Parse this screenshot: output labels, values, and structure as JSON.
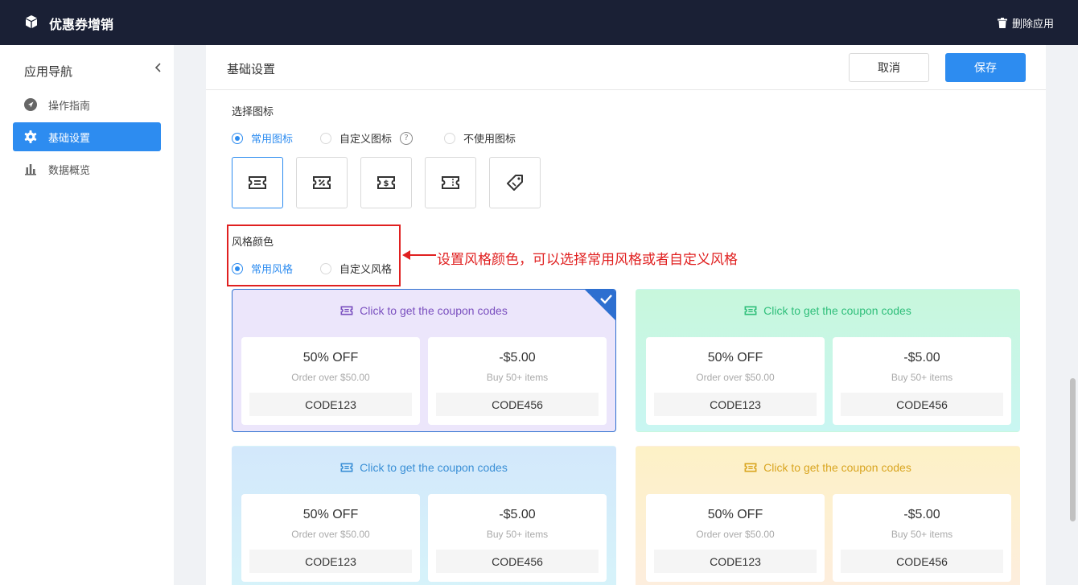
{
  "header": {
    "app_title": "优惠券增销",
    "delete_label": "删除应用"
  },
  "sidebar": {
    "title": "应用导航",
    "items": [
      {
        "label": "操作指南",
        "icon": "navigation-arrow-icon"
      },
      {
        "label": "基础设置",
        "icon": "gear-icon",
        "active": true
      },
      {
        "label": "数据概览",
        "icon": "bar-chart-icon"
      }
    ]
  },
  "main": {
    "page_title": "基础设置",
    "cancel_label": "取消",
    "save_label": "保存",
    "icon_section": {
      "label": "选择图标",
      "options": [
        "常用图标",
        "自定义图标",
        "不使用图标"
      ],
      "selected_option": "常用图标",
      "icons": [
        "ticket-icon",
        "percent-ticket-icon",
        "dollar-ticket-icon",
        "plain-ticket-icon",
        "price-tag-icon"
      ],
      "selected_icon": "ticket-icon"
    },
    "style_section": {
      "label": "风格颜色",
      "options": [
        "常用风格",
        "自定义风格"
      ],
      "selected_option": "常用风格"
    },
    "annotation": "设置风格颜色，可以选择常用风格或者自定义风格",
    "style_cards": [
      {
        "header": "Click to get the coupon codes",
        "accent": "#7a4fbf",
        "selected": true,
        "coupons": [
          {
            "amount": "50% OFF",
            "condition": "Order over $50.00",
            "code": "CODE123"
          },
          {
            "amount": "-$5.00",
            "condition": "Buy 50+ items",
            "code": "CODE456"
          }
        ]
      },
      {
        "header": "Click to get the coupon codes",
        "accent": "#2fbf7a",
        "selected": false,
        "coupons": [
          {
            "amount": "50% OFF",
            "condition": "Order over $50.00",
            "code": "CODE123"
          },
          {
            "amount": "-$5.00",
            "condition": "Buy 50+ items",
            "code": "CODE456"
          }
        ]
      },
      {
        "header": "Click to get the coupon codes",
        "accent": "#3a8fd6",
        "selected": false,
        "coupons": [
          {
            "amount": "50% OFF",
            "condition": "Order over $50.00",
            "code": "CODE123"
          },
          {
            "amount": "-$5.00",
            "condition": "Buy 50+ items",
            "code": "CODE456"
          }
        ]
      },
      {
        "header": "Click to get the coupon codes",
        "accent": "#d9a520",
        "selected": false,
        "coupons": [
          {
            "amount": "50% OFF",
            "condition": "Order over $50.00",
            "code": "CODE123"
          },
          {
            "amount": "-$5.00",
            "condition": "Buy 50+ items",
            "code": "CODE456"
          }
        ]
      }
    ]
  },
  "colors": {
    "topbar": "#1a2035",
    "primary": "#2d8cf0",
    "annotation_red": "#e02020"
  }
}
